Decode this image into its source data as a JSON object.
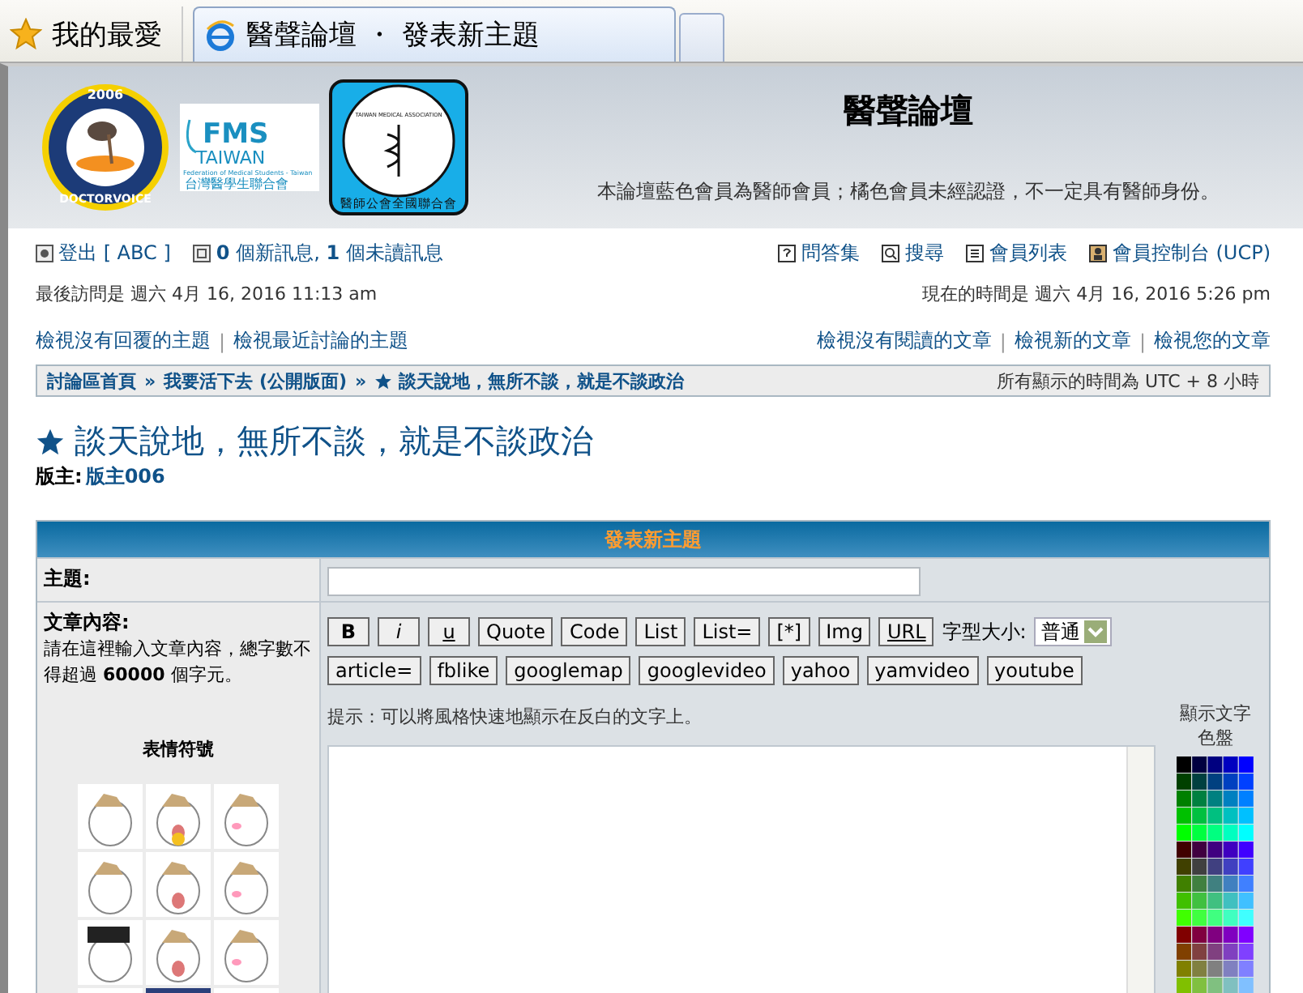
{
  "browser": {
    "favorites": "我的最愛",
    "tabs": [
      {
        "title": "醫聲論壇 ・ 發表新主題",
        "selected": true
      }
    ]
  },
  "header": {
    "logos": [
      {
        "kind": "doctorvoice",
        "texts": [
          "2006",
          "DOCTORVOICE"
        ]
      },
      {
        "kind": "fms",
        "texts": [
          "FMS",
          "TAIWAN",
          "Federation of Medical Students - Taiwan",
          "台灣醫學生聯合會"
        ]
      },
      {
        "kind": "tma",
        "texts": [
          "TAIWAN MEDICAL ASSOCIATION",
          "醫師公會全國聯合會"
        ]
      }
    ],
    "site_title": "醫聲論壇",
    "description": "本論壇藍色會員為醫師會員；橘色會員未經認證，不一定具有醫師身份。"
  },
  "user_nav": {
    "left": [
      {
        "kind": "logout",
        "text": "登出 [ ABC ]"
      },
      {
        "kind": "message",
        "text": "**0** 個新訊息, **1** 個未讀訊息"
      }
    ],
    "right": [
      {
        "kind": "faq",
        "text": "問答集"
      },
      {
        "kind": "search",
        "text": "搜尋"
      },
      {
        "kind": "members",
        "text": "會員列表"
      },
      {
        "kind": "ucp",
        "text": "會員控制台 (UCP)"
      }
    ]
  },
  "last_visit": "最後訪問是 週六 4月 16, 2016 11:13 am",
  "current_time": "現在的時間是 週六 4月 16, 2016 5:26 pm",
  "search_links": {
    "separator": "|",
    "left": [
      "檢視沒有回覆的主題",
      "檢視最近討論的主題"
    ],
    "right": [
      "檢視沒有閱讀的文章",
      "檢視新的文章",
      "檢視您的文章"
    ]
  },
  "breadcrumb": {
    "separator": "»",
    "items": [
      "討論區首頁",
      "我要活下去 (公開版面)",
      "談天說地，無所不談，就是不談政治"
    ],
    "timezone": "所有顯示的時間為 UTC + 8 小時"
  },
  "forum": {
    "title": "談天說地，無所不談，就是不談政治",
    "moderator_label": "版主:",
    "moderator": "版主006"
  },
  "post_form": {
    "heading": "發表新主題",
    "subject_label": "主題:",
    "body_label": "文章內容:",
    "body_hint": "請在這裡輸入文章內容，總字數不得超過 **60000** 個字元。",
    "smilies_title": "表情符號",
    "buttons_row1": [
      {
        "label": "B",
        "kind": "bold"
      },
      {
        "label": "i",
        "kind": "italic"
      },
      {
        "label": "u",
        "kind": "underline"
      },
      {
        "label": "Quote",
        "kind": "plain"
      },
      {
        "label": "Code",
        "kind": "plain"
      },
      {
        "label": "List",
        "kind": "plain"
      },
      {
        "label": "List=",
        "kind": "plain"
      },
      {
        "label": "[*]",
        "kind": "plain"
      },
      {
        "label": "Img",
        "kind": "plain"
      },
      {
        "label": "URL",
        "kind": "underline"
      }
    ],
    "font_size_label": "字型大小:",
    "font_size_value": "普通",
    "buttons_row2": [
      "article=",
      "fblike",
      "googlemap",
      "googlevideo",
      "yahoo",
      "yamvideo",
      "youtube"
    ],
    "tip": "提示：可以將風格快速地顯示在反白的文字上。",
    "palette_label": "顯示文字色盤"
  }
}
